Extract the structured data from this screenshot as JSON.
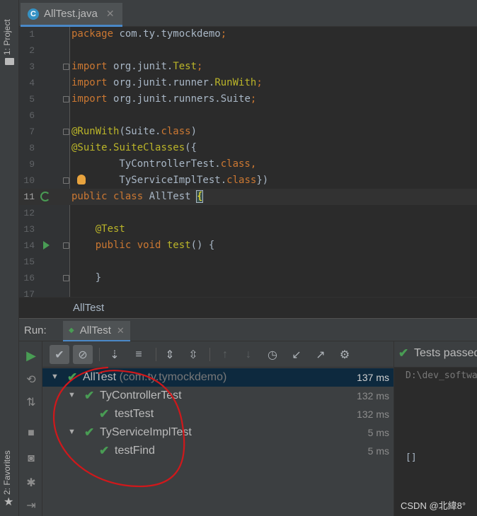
{
  "left_strip": {
    "project_label": "1: Project",
    "favorites_label": "2: Favorites"
  },
  "editor_tab": {
    "label": "AllTest.java",
    "icon_letter": "C"
  },
  "editor": {
    "current_line": 11,
    "lines": [
      {
        "num": "1",
        "tokens": [
          {
            "t": "package ",
            "c": "kw"
          },
          {
            "t": "com.ty.tymockdemo",
            "c": ""
          },
          {
            "t": ";",
            "c": "kw"
          }
        ]
      },
      {
        "num": "2",
        "tokens": []
      },
      {
        "num": "3",
        "tokens": [
          {
            "t": "import ",
            "c": "kw"
          },
          {
            "t": "org.junit.",
            "c": ""
          },
          {
            "t": "Test",
            "c": "ann"
          },
          {
            "t": ";",
            "c": "kw"
          }
        ],
        "fold": true
      },
      {
        "num": "4",
        "tokens": [
          {
            "t": "import ",
            "c": "kw"
          },
          {
            "t": "org.junit.runner.",
            "c": ""
          },
          {
            "t": "RunWith",
            "c": "ann"
          },
          {
            "t": ";",
            "c": "kw"
          }
        ]
      },
      {
        "num": "5",
        "tokens": [
          {
            "t": "import ",
            "c": "kw"
          },
          {
            "t": "org.junit.runners.",
            "c": ""
          },
          {
            "t": "Suite",
            "c": ""
          },
          {
            "t": ";",
            "c": "kw"
          }
        ],
        "fold": true
      },
      {
        "num": "6",
        "tokens": []
      },
      {
        "num": "7",
        "tokens": [
          {
            "t": "@RunWith",
            "c": "ann"
          },
          {
            "t": "(Suite.",
            "c": ""
          },
          {
            "t": "class",
            "c": "kw"
          },
          {
            "t": ")",
            "c": ""
          }
        ],
        "fold": true
      },
      {
        "num": "8",
        "tokens": [
          {
            "t": "@Suite.",
            "c": "ann"
          },
          {
            "t": "SuiteClasses",
            "c": "ann"
          },
          {
            "t": "({",
            "c": ""
          }
        ]
      },
      {
        "num": "9",
        "tokens": [
          {
            "t": "        TyControllerTest.",
            "c": ""
          },
          {
            "t": "class",
            "c": "kw"
          },
          {
            "t": ",",
            "c": "kw"
          }
        ]
      },
      {
        "num": "10",
        "tokens": [
          {
            "t": "        TyServiceImplTest.",
            "c": ""
          },
          {
            "t": "class",
            "c": "kw"
          },
          {
            "t": "})",
            "c": ""
          }
        ],
        "fold": true,
        "bulb": true
      },
      {
        "num": "11",
        "tokens": [
          {
            "t": "public ",
            "c": "kw"
          },
          {
            "t": "class ",
            "c": "kw"
          },
          {
            "t": "AllTest ",
            "c": ""
          },
          {
            "t": "{",
            "c": "brace"
          }
        ],
        "run_all": true
      },
      {
        "num": "12",
        "tokens": []
      },
      {
        "num": "13",
        "tokens": [
          {
            "t": "    @Test",
            "c": "ann"
          }
        ]
      },
      {
        "num": "14",
        "tokens": [
          {
            "t": "    public ",
            "c": "kw"
          },
          {
            "t": "void ",
            "c": "kw"
          },
          {
            "t": "test",
            "c": "ann"
          },
          {
            "t": "() {",
            "c": ""
          }
        ],
        "fold": true,
        "run": true
      },
      {
        "num": "15",
        "tokens": []
      },
      {
        "num": "16",
        "tokens": [
          {
            "t": "    }",
            "c": ""
          }
        ],
        "fold": true
      },
      {
        "num": "17",
        "tokens": []
      }
    ]
  },
  "breadcrumb": "AllTest",
  "run_panel": {
    "title": "Run:",
    "tab_label": "AllTest",
    "status": "Tests passed",
    "console_path": "D:\\dev_software",
    "console_output": "[]",
    "tree": [
      {
        "name": "AllTest",
        "pkg": " (com.ty.tymockdemo)",
        "time": "137 ms",
        "depth": 0,
        "expandable": true,
        "selected": true
      },
      {
        "name": "TyControllerTest",
        "pkg": "",
        "time": "132 ms",
        "depth": 1,
        "expandable": true
      },
      {
        "name": "testTest",
        "pkg": "",
        "time": "132 ms",
        "depth": 2,
        "expandable": false
      },
      {
        "name": "TyServiceImplTest",
        "pkg": "",
        "time": "5 ms",
        "depth": 1,
        "expandable": true
      },
      {
        "name": "testFind",
        "pkg": "",
        "time": "5 ms",
        "depth": 2,
        "expandable": false
      }
    ]
  },
  "watermark": "CSDN @北緯8°",
  "colors": {
    "accent": "#4a88c7",
    "success": "#499c54",
    "annotation": "#d0181b"
  }
}
